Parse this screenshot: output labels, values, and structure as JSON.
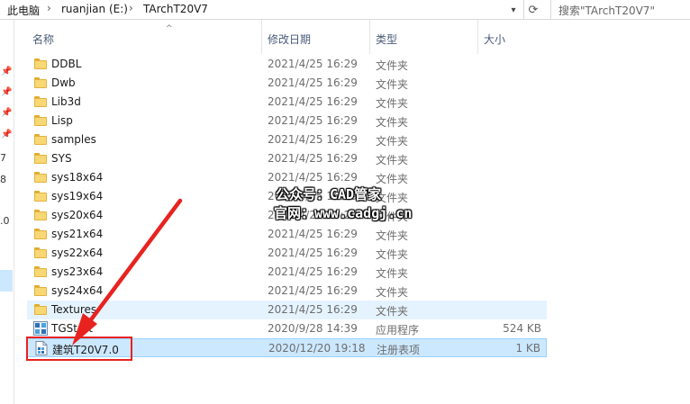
{
  "address_bar": {
    "crumbs": [
      "此电脑",
      "ruanjian (E:)",
      "TArchT20V7"
    ]
  },
  "search": {
    "placeholder": "搜索\"TArchT20V7\""
  },
  "left_nav": {
    "labels": [
      "7",
      "8",
      ".0"
    ]
  },
  "columns": {
    "name": "名称",
    "date": "修改日期",
    "type": "类型",
    "size": "大小"
  },
  "rows": [
    {
      "name": "DDBL",
      "date": "2021/4/25 16:29",
      "type": "文件夹",
      "size": "",
      "icon": "folder-icon"
    },
    {
      "name": "Dwb",
      "date": "2021/4/25 16:29",
      "type": "文件夹",
      "size": "",
      "icon": "folder-icon"
    },
    {
      "name": "Lib3d",
      "date": "2021/4/25 16:29",
      "type": "文件夹",
      "size": "",
      "icon": "folder-icon"
    },
    {
      "name": "Lisp",
      "date": "2021/4/25 16:29",
      "type": "文件夹",
      "size": "",
      "icon": "folder-icon"
    },
    {
      "name": "samples",
      "date": "2021/4/25 16:29",
      "type": "文件夹",
      "size": "",
      "icon": "folder-icon"
    },
    {
      "name": "SYS",
      "date": "2021/4/25 16:29",
      "type": "文件夹",
      "size": "",
      "icon": "folder-icon"
    },
    {
      "name": "sys18x64",
      "date": "2021/4/25 16:29",
      "type": "文件夹",
      "size": "",
      "icon": "folder-icon"
    },
    {
      "name": "sys19x64",
      "date": "2021/4/25 16:29",
      "type": "文件夹",
      "size": "",
      "icon": "folder-icon"
    },
    {
      "name": "sys20x64",
      "date": "2021/4/25 16:29",
      "type": "文件夹",
      "size": "",
      "icon": "folder-icon"
    },
    {
      "name": "sys21x64",
      "date": "2021/4/25 16:29",
      "type": "文件夹",
      "size": "",
      "icon": "folder-icon"
    },
    {
      "name": "sys22x64",
      "date": "2021/4/25 16:29",
      "type": "文件夹",
      "size": "",
      "icon": "folder-icon"
    },
    {
      "name": "sys23x64",
      "date": "2021/4/25 16:29",
      "type": "文件夹",
      "size": "",
      "icon": "folder-icon"
    },
    {
      "name": "sys24x64",
      "date": "2021/4/25 16:29",
      "type": "文件夹",
      "size": "",
      "icon": "folder-icon"
    },
    {
      "name": "Textures",
      "date": "2021/4/25 16:29",
      "type": "文件夹",
      "size": "",
      "icon": "folder-icon"
    },
    {
      "name": "TGStart",
      "date": "2020/9/28 14:39",
      "type": "应用程序",
      "size": "524 KB",
      "icon": "application-icon"
    },
    {
      "name": "建筑T20V7.0",
      "date": "2020/12/20 19:18",
      "type": "注册表项",
      "size": "1 KB",
      "icon": "registry-file-icon"
    }
  ],
  "watermark": {
    "line1": "公众号：CAD管家",
    "line2": "官网：www.cadgj.cn"
  },
  "colors": {
    "selection": "#cce8ff",
    "hover": "#e5f3ff",
    "annotation_red": "#e8231f",
    "folder": "#f8d775"
  }
}
